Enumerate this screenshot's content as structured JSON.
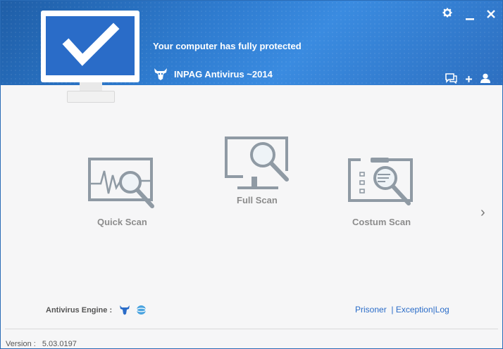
{
  "header": {
    "status_title": "Your computer has fully protected",
    "product_name": "INPAG Antivirus ~2014",
    "icons": [
      "gear-icon",
      "minimize-icon",
      "close-icon",
      "chat-icon",
      "add-icon",
      "user-icon"
    ]
  },
  "scans": {
    "quick": {
      "label": "Quick Scan",
      "icon": "quick-scan-icon"
    },
    "full": {
      "label": "Full Scan",
      "icon": "full-scan-icon"
    },
    "custom": {
      "label": "Costum Scan",
      "icon": "custom-scan-icon"
    }
  },
  "next_arrow": "›",
  "footer": {
    "engine_label": "Antivirus Engine :",
    "links": {
      "prisoner": "Prisoner",
      "exception": "Exception",
      "log": "Log"
    },
    "version_label": "Version :",
    "version_value": "5.03.0197"
  },
  "colors": {
    "header_blue": "#2f7cd0",
    "link_blue": "#2a6cc8",
    "icon_gray": "#8f9aa4"
  }
}
